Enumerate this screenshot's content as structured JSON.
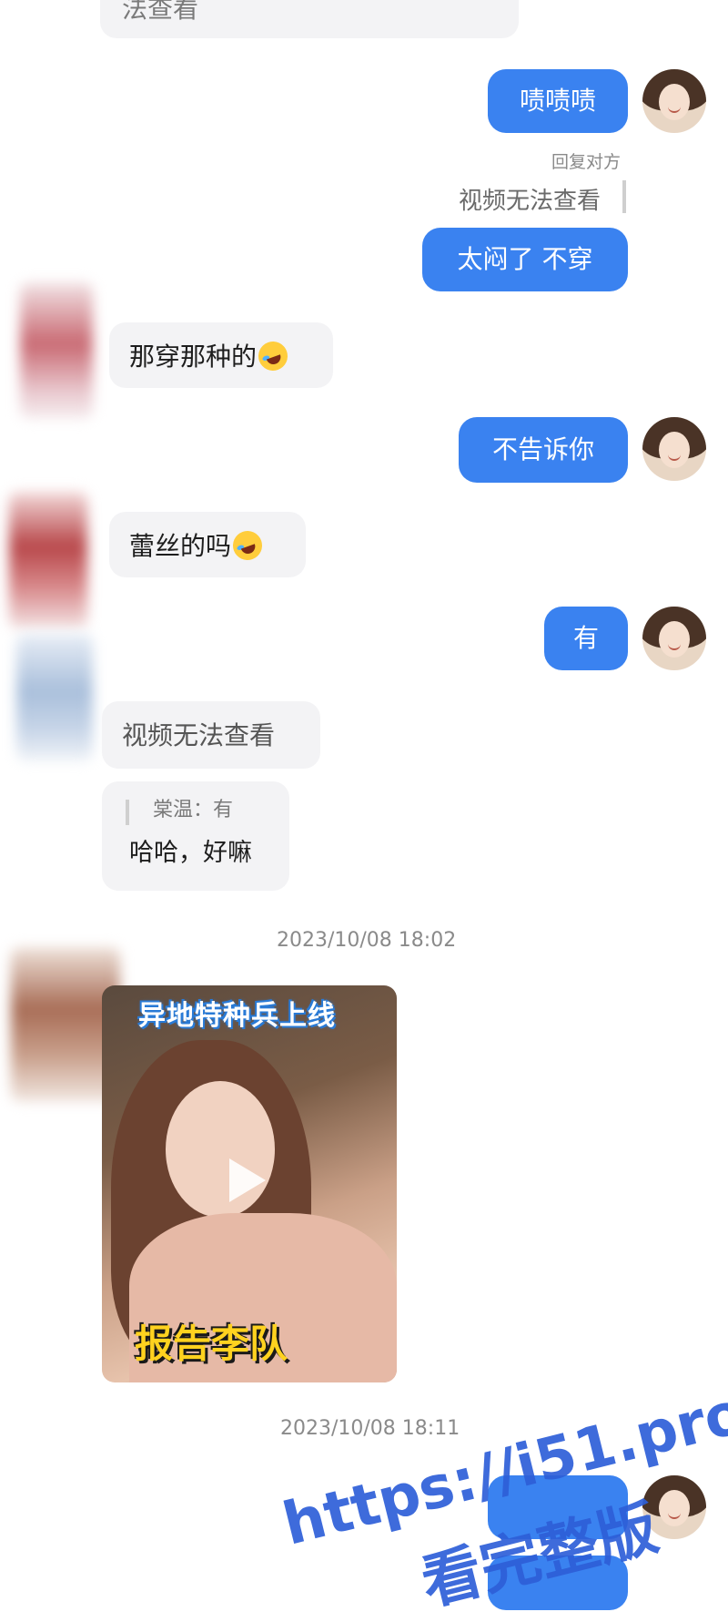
{
  "messages": {
    "top_partial": "法查看",
    "out_1": "啧啧啧",
    "reply_hint": "回复对方",
    "quoted_text": "视频无法查看",
    "out_2": "太闷了 不穿",
    "in_1": "那穿那种的",
    "out_3": "不告诉你",
    "in_2": "蕾丝的吗",
    "out_4": "有",
    "in_video_unavailable": "视频无法查看",
    "in_quote_author": "棠温：有",
    "in_quote_reply": "哈哈，好嘛",
    "time_1": "2023/10/08 18:02",
    "video_caption_top": "异地特种兵上线",
    "video_caption_bottom": "报告李队",
    "time_2": "2023/10/08 18:11"
  },
  "watermark": {
    "url": "https://i51.pro",
    "line2": "看完整版"
  },
  "colors": {
    "outgoing_bubble": "#3a82f0",
    "incoming_bubble": "#f3f3f5",
    "watermark": "#2e5fd8"
  }
}
